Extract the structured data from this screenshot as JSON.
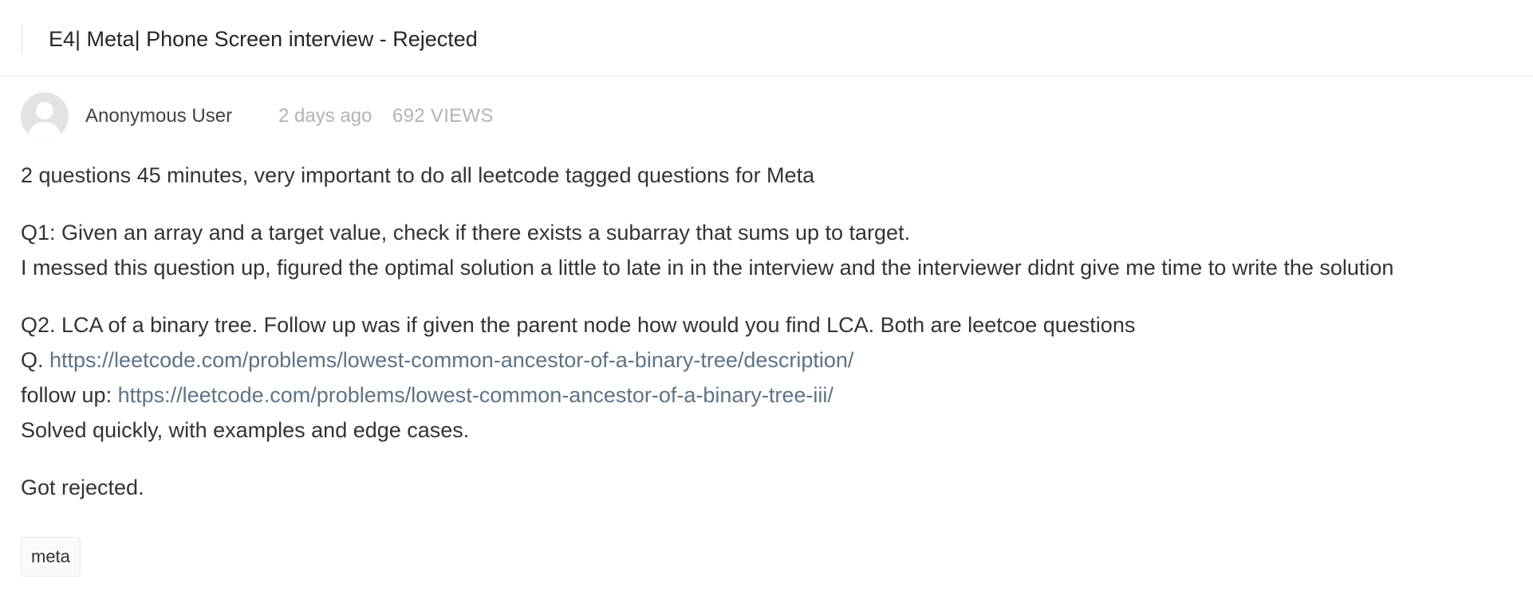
{
  "post": {
    "title": "E4| Meta| Phone Screen interview - Rejected",
    "author": "Anonymous User",
    "time": "2 days ago",
    "views": "692 VIEWS",
    "icons": {
      "avatar": "user-avatar-icon"
    }
  },
  "body": {
    "p1": "2 questions 45 minutes, very important to do all leetcode tagged questions for Meta",
    "p2_line1": "Q1: Given an array and a target value, check if there exists a subarray that sums up to target.",
    "p2_line2": "I messed this question up, figured the optimal solution a little to late in in the interview and the interviewer didnt give me time to write the solution",
    "p3_line1": "Q2. LCA of a binary tree. Follow up was if given the parent node how would you find LCA. Both are leetcoe questions",
    "p3_line2_prefix": "Q. ",
    "p3_link1": "https://leetcode.com/problems/lowest-common-ancestor-of-a-binary-tree/description/",
    "p3_line3_prefix": "follow up: ",
    "p3_link2": "https://leetcode.com/problems/lowest-common-ancestor-of-a-binary-tree-iii/",
    "p3_line4": "Solved quickly, with examples and edge cases.",
    "p4": "Got rejected."
  },
  "tags": [
    {
      "label": "meta"
    }
  ],
  "colors": {
    "link": "#5d7386",
    "muted": "#b3b3b3",
    "text": "#333333",
    "border": "#e8e8e8"
  }
}
